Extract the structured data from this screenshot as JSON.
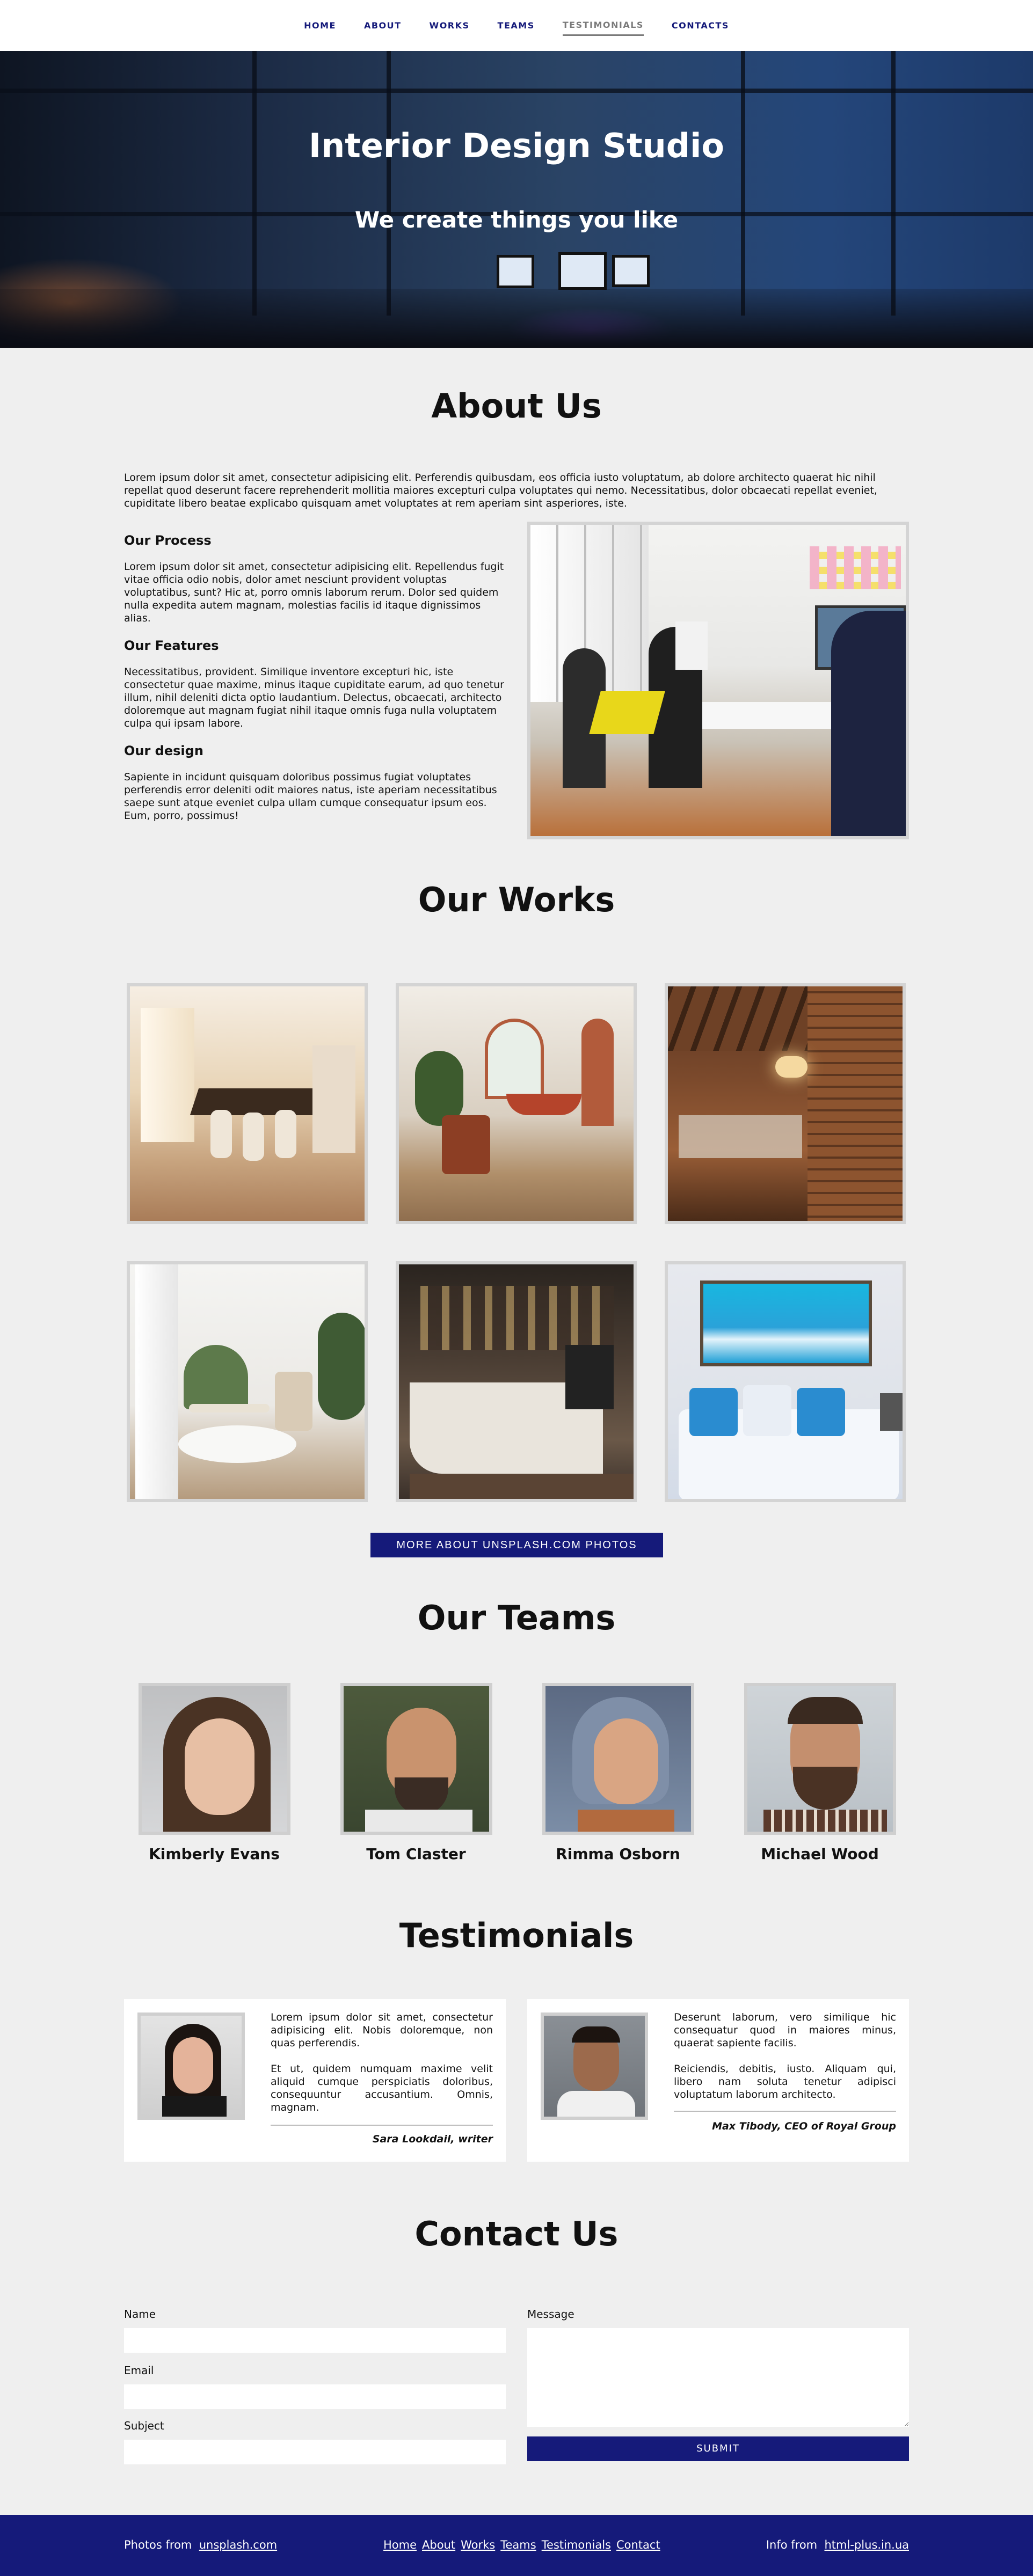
{
  "nav": {
    "items": [
      {
        "label": "HOME"
      },
      {
        "label": "ABOUT"
      },
      {
        "label": "WORKS"
      },
      {
        "label": "TEAMS"
      },
      {
        "label": "TESTIMONIALS",
        "active": true
      },
      {
        "label": "CONTACTS"
      }
    ]
  },
  "hero": {
    "title": "Interior Design Studio",
    "subtitle": "We create things you like"
  },
  "about": {
    "title": "About Us",
    "intro": "Lorem ipsum dolor sit amet, consectetur adipisicing elit. Perferendis quibusdam, eos officia iusto voluptatum, ab dolore architecto quaerat hic nihil repellat quod deserunt facere reprehenderit mollitia maiores excepturi culpa voluptates qui nemo. Necessitatibus, dolor obcaecati repellat eveniet, cupiditate libero beatae explicabo quisquam amet voluptates at rem aperiam sint asperiores, iste.",
    "blocks": [
      {
        "heading": "Our Process",
        "text": "Lorem ipsum dolor sit amet, consectetur adipisicing elit. Repellendus fugit vitae officia odio nobis, dolor amet nesciunt provident voluptas voluptatibus, sunt? Hic at, porro omnis laborum rerum. Dolor sed quidem nulla expedita autem magnam, molestias facilis id itaque dignissimos alias."
      },
      {
        "heading": "Our Features",
        "text": "Necessitatibus, provident. Similique inventore excepturi hic, iste consectetur quae maxime, minus itaque cupiditate earum, ad quo tenetur illum, nihil deleniti dicta optio laudantium. Delectus, obcaecati, architecto doloremque aut magnam fugiat nihil itaque omnis fuga nulla voluptatem culpa qui ipsam labore."
      },
      {
        "heading": "Our design",
        "text": "Sapiente in incidunt quisquam doloribus possimus fugiat voluptates perferendis error deleniti odit maiores natus, iste aperiam necessitatibus saepe sunt atque eveniet culpa ullam cumque consequatur ipsum eos. Eum, porro, possimus!"
      }
    ]
  },
  "works": {
    "title": "Our Works",
    "button_label": "MORE ABOUT UNSPLASH.COM PHOTOS"
  },
  "teams": {
    "title": "Our Teams",
    "members": [
      {
        "name": "Kimberly Evans"
      },
      {
        "name": "Tom Claster"
      },
      {
        "name": "Rimma Osborn"
      },
      {
        "name": "Michael Wood"
      }
    ]
  },
  "testimonials": {
    "title": "Testimonials",
    "items": [
      {
        "p1": "Lorem ipsum dolor sit amet, consectetur adipisicing elit. Nobis doloremque, non quas perferendis.",
        "p2": "Et ut, quidem numquam maxime velit aliquid cumque perspiciatis doloribus, consequuntur accusantium. Omnis, magnam.",
        "author": "Sara Lookdail, writer"
      },
      {
        "p1": "Deserunt laborum, vero similique hic consequatur quod in maiores minus, quaerat sapiente facilis.",
        "p2": "Reiciendis, debitis, iusto. Aliquam qui, libero nam soluta tenetur adipisci voluptatum laborum architecto.",
        "author": "Max Tibody, CEO of Royal Group"
      }
    ]
  },
  "contact": {
    "title": "Contact Us",
    "name_label": "Name",
    "email_label": "Email",
    "subject_label": "Subject",
    "message_label": "Message",
    "submit_label": "SUBMIT"
  },
  "footer": {
    "photos_prefix": "Photos from",
    "photos_link": "unsplash.com",
    "links": [
      "Home",
      "About",
      "Works",
      "Teams",
      "Testimonials",
      "Contact"
    ],
    "info_prefix": "Info from",
    "info_link": "html-plus.in.ua"
  },
  "colors": {
    "accent": "#151a7a",
    "background": "#efefef",
    "card": "#ffffff"
  }
}
